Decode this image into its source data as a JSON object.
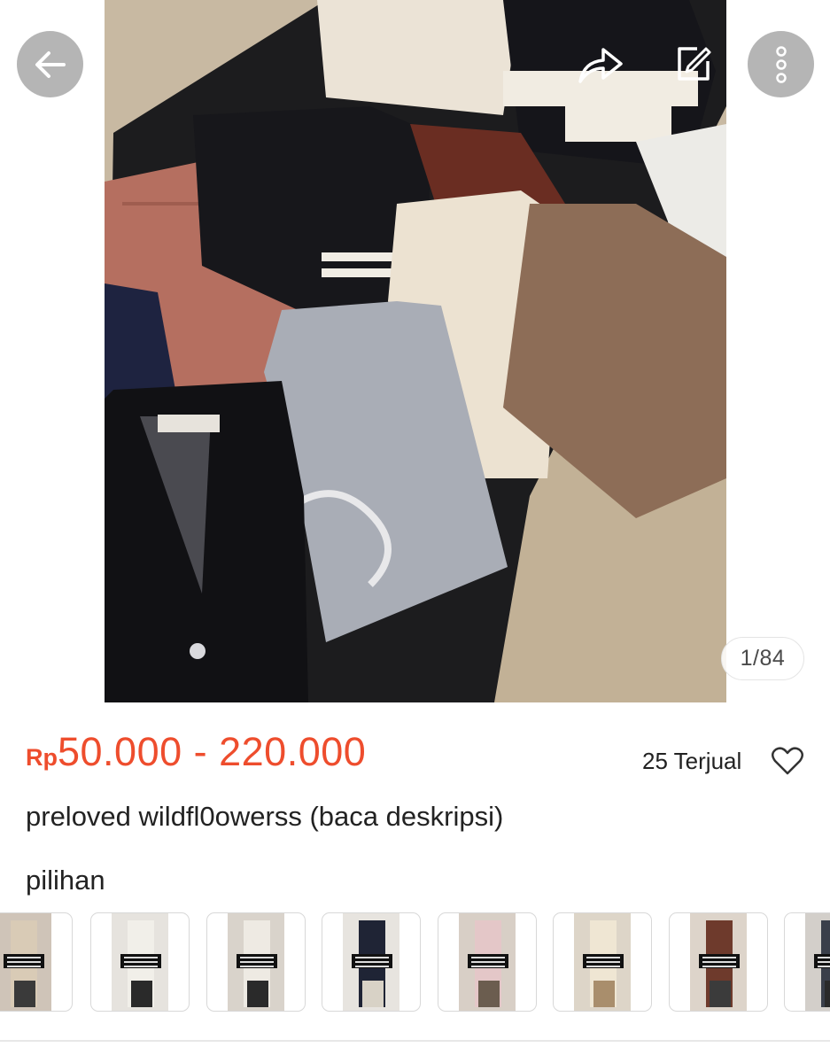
{
  "gallery": {
    "counter": "1/84",
    "image_description_icon": "clothes-photo"
  },
  "toolbar": {
    "back_icon": "arrow-left-icon",
    "share_icon": "share-icon",
    "edit_icon": "edit-icon",
    "more_icon": "more-vertical-icon"
  },
  "product": {
    "currency": "Rp",
    "price": "50.000 - 220.000",
    "sold": "25 Terjual",
    "title": "preloved wildfl0owerss (baca deskripsi)"
  },
  "options": {
    "label": "pilihan",
    "thumbnails": [
      {
        "pants": "#d9cbb6",
        "backdrop": "#cfc4b8",
        "inset": "#3a3a3a"
      },
      {
        "pants": "#f1efe9",
        "backdrop": "#e6e3de",
        "inset": "#2a2a2a"
      },
      {
        "pants": "#eeeae3",
        "backdrop": "#d9d3cb",
        "inset": "#2a2a2a"
      },
      {
        "pants": "#1f2435",
        "backdrop": "#e7e4df",
        "inset": "#d8d2c6"
      },
      {
        "pants": "#e4c7c8",
        "backdrop": "#d8cfc6",
        "inset": "#6b5d4f"
      },
      {
        "pants": "#efe6d3",
        "backdrop": "#ddd5c8",
        "inset": "#a98e6c"
      },
      {
        "pants": "#6e3a2c",
        "backdrop": "#ddd4ca",
        "inset": "#3b3b3b"
      },
      {
        "pants": "#3a3f4a",
        "backdrop": "#d3cfca",
        "inset": "#2a2a2a"
      }
    ]
  },
  "colors": {
    "accent": "#ee4d2d",
    "text": "#222222"
  }
}
